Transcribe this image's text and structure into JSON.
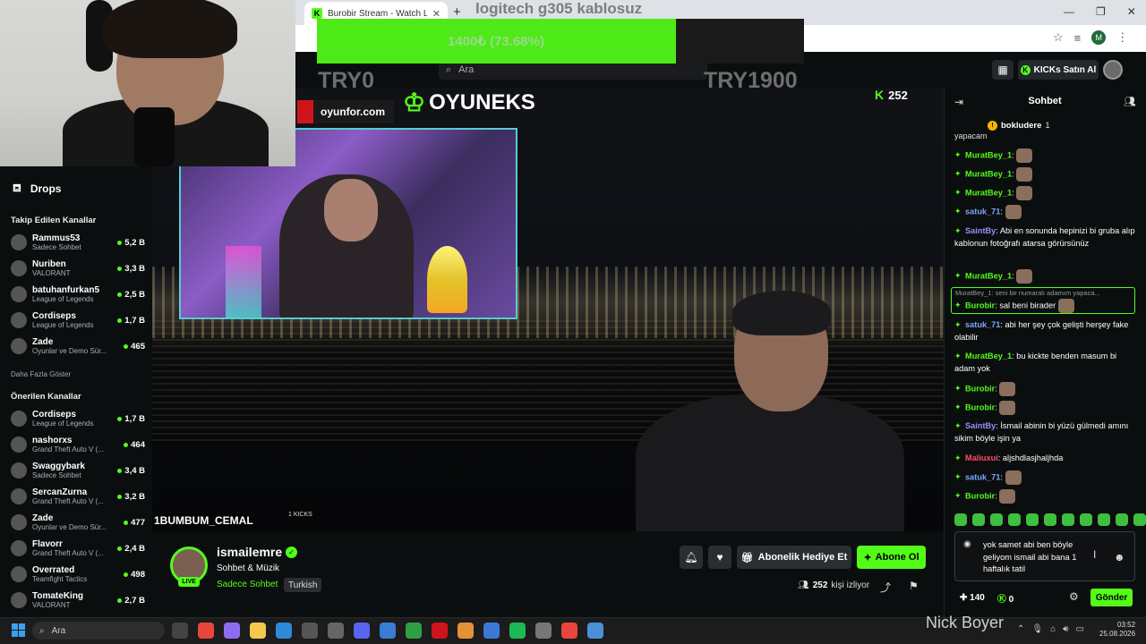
{
  "browser": {
    "tab_title": "Burobir Stream - Watch Live on",
    "tab_favicon": "K",
    "new_tab": "+",
    "overlay_search_text": "logitech g305 kablosuz"
  },
  "kick_header": {
    "search_placeholder": "Ara",
    "kicks_button": "KICKs Satın Al"
  },
  "goal": {
    "text": "1400₺ (73.68%)",
    "progress": 0.7368,
    "min_label": "TRY0",
    "max_label": "TRY1900"
  },
  "sidebar": {
    "drops_label": "Drops",
    "followed_title": "Takip Edilen Kanallar",
    "followed": [
      {
        "name": "Rammus53",
        "category": "Sadece Sohbet",
        "viewers": "5,2 B"
      },
      {
        "name": "Nuriben",
        "category": "VALORANT",
        "viewers": "3,3 B"
      },
      {
        "name": "batuhanfurkan5",
        "category": "League of Legends",
        "viewers": "2,5 B"
      },
      {
        "name": "Cordiseps",
        "category": "League of Legends",
        "viewers": "1,7 B"
      },
      {
        "name": "Zade",
        "category": "Oyunlar ve Demo Sür...",
        "viewers": "465"
      }
    ],
    "show_more": "Daha Fazla Göster",
    "recommended_title": "Önerilen Kanallar",
    "recommended": [
      {
        "name": "Cordiseps",
        "category": "League of Legends",
        "viewers": "1,7 B"
      },
      {
        "name": "nashorxs",
        "category": "Grand Theft Auto V (...",
        "viewers": "464"
      },
      {
        "name": "Swaggybark",
        "category": "Sadece Sohbet",
        "viewers": "3,4 B"
      },
      {
        "name": "SercanZurna",
        "category": "Grand Theft Auto V (...",
        "viewers": "3,2 B"
      },
      {
        "name": "Zade",
        "category": "Oyunlar ve Demo Sür...",
        "viewers": "477"
      },
      {
        "name": "Flavorr",
        "category": "Grand Theft Auto V (...",
        "viewers": "2,4 B"
      },
      {
        "name": "Overrated",
        "category": "Teamfight Tactics",
        "viewers": "498"
      },
      {
        "name": "TomateKing",
        "category": "VALORANT",
        "viewers": "2,7 B"
      }
    ]
  },
  "player": {
    "sponsor1": "oyunfor.com",
    "sponsor2": "OYUNEKS",
    "viewer_count_overlay": "252",
    "sub_label": "1BUMBUM_CEMAL",
    "kicks_label": "1 KICKS"
  },
  "channel": {
    "name": "ismailemre",
    "title": "Sohbet & Müzik",
    "category": "Sadece Sohbet",
    "tag": "Turkish",
    "live_badge": "LIVE",
    "gift_button": "Abonelik Hediye Et",
    "subscribe_button": "Abone Ol",
    "viewers": "252",
    "viewers_suffix": "kişi izliyor"
  },
  "chat": {
    "title": "Sohbet",
    "pinned_user": "bokludere",
    "pinned_count": "1",
    "partial_top": "yapacam",
    "messages": [
      {
        "user": "MuratBey_1",
        "text": "",
        "color": "#53fc18",
        "emote": true
      },
      {
        "user": "MuratBey_1",
        "text": "",
        "color": "#53fc18",
        "emote": true
      },
      {
        "user": "MuratBey_1",
        "text": "",
        "color": "#53fc18",
        "emote": true
      },
      {
        "user": "satuk_71",
        "text": "",
        "color": "#7aa7ff",
        "emote": true
      },
      {
        "user": "SaintBy",
        "text": "Abi en sonunda hepinizi bi gruba alıp kablonun fotoğrafı atarsa görürsünüz",
        "color": "#9b8cff",
        "emote": false
      },
      {
        "user": "MuratBey_1",
        "text": "",
        "color": "#53fc18",
        "emote": true
      },
      {
        "user": "Burobir",
        "text": "sal beni birader",
        "color": "#53fc18",
        "emote": true
      },
      {
        "user": "satuk_71",
        "text": "abi her şey çok gelişti herşey fake olabilir",
        "color": "#7aa7ff",
        "emote": false
      },
      {
        "user": "MuratBey_1",
        "text": "bu kickte benden masum bi adam yok",
        "color": "#53fc18",
        "emote": false
      },
      {
        "user": "Burobir",
        "text": "",
        "color": "#53fc18",
        "emote": true
      },
      {
        "user": "Burobir",
        "text": "",
        "color": "#53fc18",
        "emote": true
      },
      {
        "user": "SaintBy",
        "text": "İsmail abinin bi yüzü gülmedi amını sikim böyle işin ya",
        "color": "#9b8cff",
        "emote": false
      },
      {
        "user": "Maliuxui",
        "text": "aljshdlasjhaljhda",
        "color": "#ff4d6a",
        "emote": false
      },
      {
        "user": "satuk_71",
        "text": "",
        "color": "#7aa7ff",
        "emote": true
      },
      {
        "user": "Burobir",
        "text": "",
        "color": "#53fc18",
        "emote": true
      }
    ],
    "reply_ref": "MuratBey_1: seni bir numaralı adamım yapaca...",
    "input_text": "yok samet abi ben böyle geliyom ismail abi bana 1 haftalık tatil",
    "footer_left": "140",
    "footer_kicks": "0",
    "send_button": "Gönder"
  },
  "taskbar": {
    "search_placeholder": "Ara",
    "overlay_name": "Nick Boyer",
    "time": "03:52",
    "date": "25.08.2026"
  },
  "colors": {
    "accent": "#53fc18",
    "background": "#0b0e0f"
  }
}
